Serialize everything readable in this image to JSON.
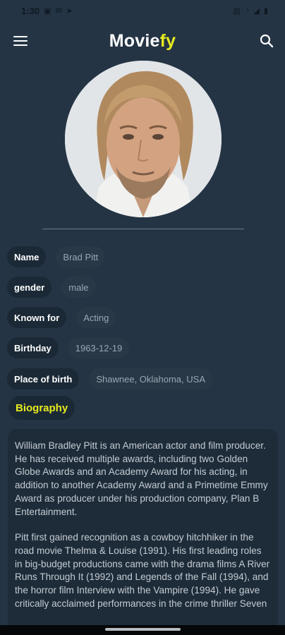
{
  "status_bar": {
    "time": "1:30"
  },
  "app_bar": {
    "brand_white": "Movie",
    "brand_yellow": "fy"
  },
  "person": {
    "rows": [
      {
        "key": "Name",
        "value": "Brad Pitt"
      },
      {
        "key": "gender",
        "value": "male"
      },
      {
        "key": "Known for",
        "value": "Acting"
      },
      {
        "key": "Birthday",
        "value": "1963-12-19"
      },
      {
        "key": "Place of birth",
        "value": "Shawnee, Oklahoma, USA"
      }
    ]
  },
  "biography": {
    "label": "Biography",
    "paragraphs": [
      "William Bradley Pitt is an American actor and film producer. He has received multiple awards, including two Golden Globe Awards and an Academy Award for his acting, in addition to another Academy Award and a Primetime Emmy Award as producer under his production company, Plan B Entertainment.",
      "Pitt first gained recognition as a cowboy hitchhiker in the road movie Thelma & Louise (1991). His first leading roles in big-budget productions came with the drama films A River Runs Through It (1992) and Legends of the Fall (1994), and the horror film Interview with the Vampire (1994). He gave critically acclaimed performances in the crime thriller Seven"
    ]
  }
}
